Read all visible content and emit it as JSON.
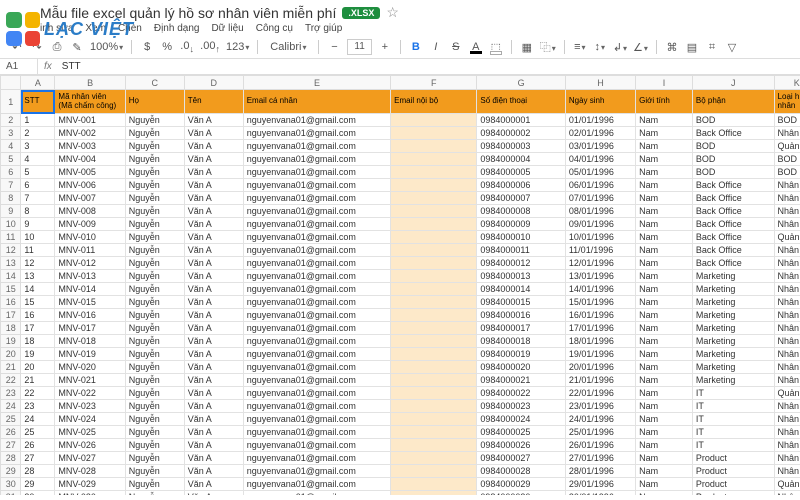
{
  "doc": {
    "title": "Mẫu file excel quản lý hồ sơ nhân viên miễn phí",
    "ext_badge": ".XLSX",
    "menus": [
      "inh sửa",
      "Xem",
      "Chèn",
      "Định dạng",
      "Dữ liệu",
      "Công cụ",
      "Trợ giúp"
    ]
  },
  "logo_text": "LẠC VIỆT",
  "toolbar": {
    "zoom": "100%",
    "currency": "$",
    "percent": "%",
    "dec": ".0",
    "dec2": ".00",
    "pts": "123",
    "font": "Calibri",
    "size": "11",
    "bold": "B",
    "italic": "I",
    "strike": "S",
    "textcolor": "A",
    "fill": "▦",
    "borders": "▦",
    "merge": "⧉",
    "halign": "≡",
    "valign": "≡",
    "wrap": "↲",
    "rotate": "∠",
    "link": "⧉",
    "comment": "▤",
    "chart": "▥",
    "filter": "▽"
  },
  "cellref": {
    "addr": "A1",
    "fx_label": "fx",
    "value": "STT"
  },
  "columns_letters": [
    "A",
    "B",
    "C",
    "D",
    "E",
    "F",
    "G",
    "H",
    "I",
    "J",
    "K"
  ],
  "headers": {
    "A": "STT",
    "B": "Mã nhân viên (Mã chấm công)",
    "C": "Họ",
    "D": "Tên",
    "E": "Email cá nhân",
    "F": "Email nội bộ",
    "G": "Số điện thoại",
    "H": "Ngày sinh",
    "I": "Giới tính",
    "J": "Bộ phận",
    "K": "Loại h nhân"
  },
  "base": {
    "ho": "Nguyễn",
    "ten": "Văn A",
    "email": "nguyenvana01@gmail.com",
    "gioitinh": "Nam"
  },
  "departments": [
    "BOD",
    "Back Office",
    "BOD",
    "BOD",
    "BOD",
    "Back Office",
    "Back Office",
    "Back Office",
    "Back Office",
    "Back Office",
    "Back Office",
    "Back Office",
    "Marketing",
    "Marketing",
    "Marketing",
    "Marketing",
    "Marketing",
    "Marketing",
    "Marketing",
    "Marketing",
    "Marketing",
    "IT",
    "IT",
    "IT",
    "IT",
    "IT",
    "Product",
    "Product",
    "Product",
    "Product"
  ],
  "job_prefix": [
    "BOD",
    "Nhân",
    "Quản",
    "BOD",
    "BOD",
    "Nhân",
    "Nhân",
    "Nhân",
    "Nhân",
    "Quản",
    "Nhân",
    "Nhân",
    "Nhân",
    "Nhân",
    "Nhân",
    "Nhân",
    "Nhân",
    "Nhân",
    "Nhân",
    "Nhân",
    "Nhân",
    "Quản",
    "Nhân",
    "Nhân",
    "Nhân",
    "Nhân",
    "Nhân",
    "Nhân",
    "Quản",
    "Nhân"
  ],
  "chart_data": null
}
